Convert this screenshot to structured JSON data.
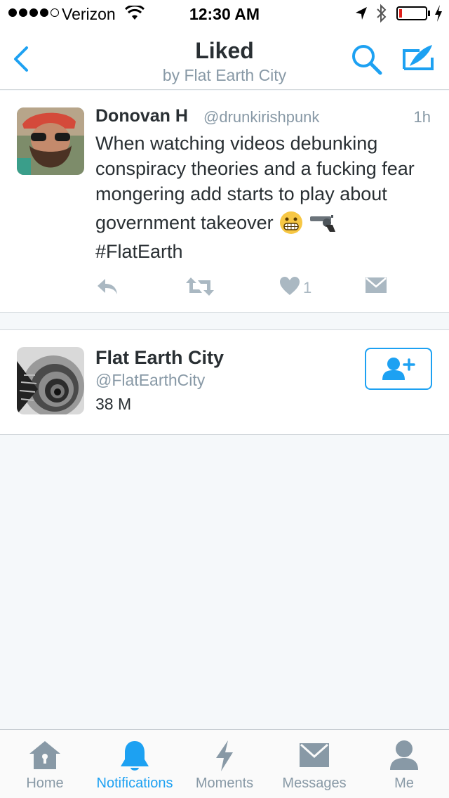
{
  "status_bar": {
    "carrier": "Verizon",
    "time": "12:30 AM",
    "battery_level": 0.1
  },
  "nav": {
    "title": "Liked",
    "subtitle": "by Flat Earth City",
    "icons": [
      "back-chevron-icon",
      "search-icon",
      "compose-icon"
    ]
  },
  "tweet": {
    "name": "Donovan H",
    "handle": "@drunkirishpunk",
    "time": "1h",
    "text_lines": [
      "When watching videos debunking",
      "conspiracy theories and a fucking fear",
      "mongering add starts to play about",
      "government takeover",
      "#FlatEarth"
    ],
    "emojis": [
      "grimacing-face-emoji",
      "pistol-emoji"
    ],
    "like_count": "1",
    "actions": [
      "reply-icon",
      "retweet-icon",
      "heart-icon",
      "message-icon"
    ]
  },
  "user_card": {
    "name": "Flat Earth City",
    "handle": "@FlatEarthCity",
    "followers": "38 M",
    "follow_icon": "add-user-icon"
  },
  "tabs": [
    {
      "label": "Home",
      "icon": "home-icon",
      "active": false
    },
    {
      "label": "Notifications",
      "icon": "bell-icon",
      "active": true
    },
    {
      "label": "Moments",
      "icon": "lightning-icon",
      "active": false
    },
    {
      "label": "Messages",
      "icon": "envelope-icon",
      "active": false
    },
    {
      "label": "Me",
      "icon": "person-icon",
      "active": false
    }
  ],
  "colors": {
    "accent": "#1da1f2",
    "muted": "#8899a6",
    "action_gray": "#aab8c2",
    "text": "#292f33",
    "background": "#f5f8fa"
  }
}
